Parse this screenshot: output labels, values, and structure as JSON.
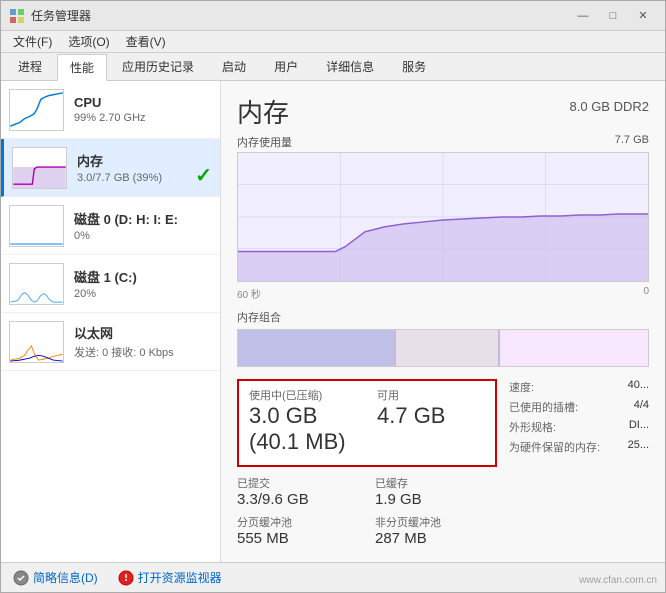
{
  "window": {
    "title": "任务管理器",
    "controls": [
      "—",
      "□",
      "✕"
    ]
  },
  "menu": {
    "items": [
      "文件(F)",
      "选项(O)",
      "查看(V)"
    ]
  },
  "tabs": [
    {
      "label": "进程",
      "active": false
    },
    {
      "label": "性能",
      "active": true
    },
    {
      "label": "应用历史记录",
      "active": false
    },
    {
      "label": "启动",
      "active": false
    },
    {
      "label": "用户",
      "active": false
    },
    {
      "label": "详细信息",
      "active": false
    },
    {
      "label": "服务",
      "active": false
    }
  ],
  "sidebar": {
    "items": [
      {
        "name": "CPU",
        "value": "99% 2.70 GHz",
        "active": false,
        "has_check": false
      },
      {
        "name": "内存",
        "value": "3.0/7.7 GB (39%)",
        "active": true,
        "has_check": true
      },
      {
        "name": "磁盘 0 (D: H: I: E:",
        "value": "0%",
        "active": false,
        "has_check": false
      },
      {
        "name": "磁盘 1 (C:)",
        "value": "20%",
        "active": false,
        "has_check": false
      },
      {
        "name": "以太网",
        "value": "发送: 0 接收: 0 Kbps",
        "active": false,
        "has_check": false
      }
    ]
  },
  "detail": {
    "title": "内存",
    "spec": "8.0 GB DDR2",
    "chart_label_left": "内存使用量",
    "chart_label_right": "7.7 GB",
    "time_label_left": "60 秒",
    "time_label_right": "0",
    "composition_label": "内存组合",
    "stats": {
      "used_label": "使用中(已压缩)",
      "used_value": "3.0 GB (40.1 MB)",
      "available_label": "可用",
      "available_value": "4.7 GB",
      "committed_label": "已提交",
      "committed_value": "3.3/9.6 GB",
      "cached_label": "已缓存",
      "cached_value": "1.9 GB",
      "paged_pool_label": "分页缓冲池",
      "paged_pool_value": "555 MB",
      "nonpaged_pool_label": "非分页缓冲池",
      "nonpaged_pool_value": "287 MB"
    },
    "right_stats": {
      "speed_label": "速度:",
      "speed_value": "40...",
      "slots_label": "已使用的插槽:",
      "slots_value": "4/4",
      "form_label": "外形规格:",
      "form_value": "DI...",
      "reserved_label": "为硬件保留的内存:",
      "reserved_value": "25..."
    }
  },
  "bottom": {
    "summary_label": "简略信息(D)",
    "monitor_label": "打开资源监视器"
  },
  "watermark": "www.cfan.com.cn"
}
